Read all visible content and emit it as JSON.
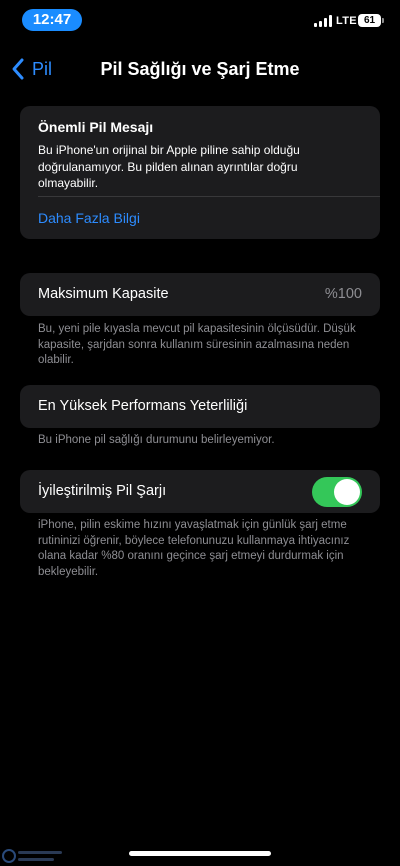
{
  "status_bar": {
    "time": "12:47",
    "network": "LTE",
    "battery_level": "61",
    "accent_color": "#1a8cff"
  },
  "nav": {
    "back_label": "Pil",
    "title": "Pil Sağlığı ve Şarj Etme",
    "back_icon": "chevron-left-icon"
  },
  "warning": {
    "title": "Önemli Pil Mesajı",
    "body": "Bu iPhone'un orijinal bir Apple piline sahip olduğu doğrulanamıyor. Bu pilden alınan ayrıntılar doğru olmayabilir.",
    "link": "Daha Fazla Bilgi"
  },
  "capacity": {
    "label": "Maksimum Kapasite",
    "value": "%100",
    "footnote": "Bu, yeni pile kıyasla mevcut pil kapasitesinin ölçüsüdür. Düşük kapasite, şarjdan sonra kullanım süresinin azalmasına neden olabilir."
  },
  "performance": {
    "label": "En Yüksek Performans Yeterliliği",
    "footnote": "Bu iPhone pil sağlığı durumunu belirleyemiyor."
  },
  "optimized": {
    "label": "İyileştirilmiş Pil Şarjı",
    "enabled": true,
    "toggle_color": "#34c759",
    "footnote": "iPhone, pilin eskime hızını yavaşlatmak için günlük şarj etme rutininizi öğrenir, böylece telefonunuzu kullanmaya ihtiyacınız olana kadar %80 oranını geçince şarj etmeyi durdurmak için bekleyebilir."
  },
  "colors": {
    "background": "#000000",
    "card": "#1c1c1e",
    "link": "#2d8cff",
    "secondary_text": "#8e8e93"
  }
}
